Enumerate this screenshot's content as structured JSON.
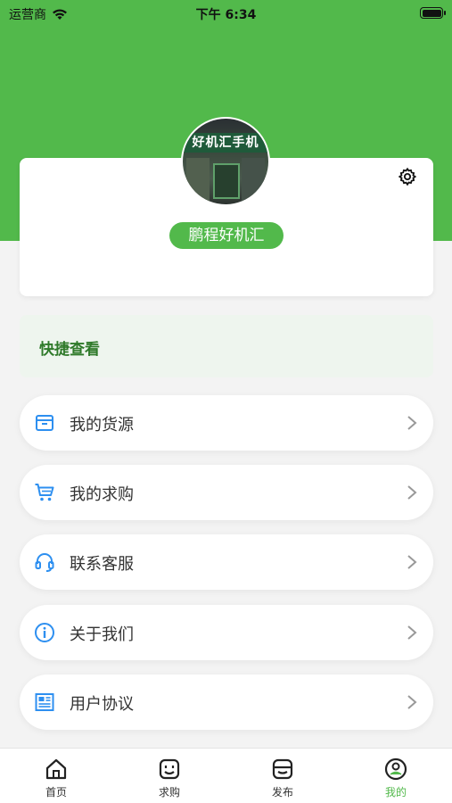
{
  "status_bar": {
    "carrier": "运营商",
    "time": "下午 6:34"
  },
  "profile": {
    "shop_name": "鹏程好机汇",
    "avatar_sign_text": "好机汇手机"
  },
  "quick_view": {
    "title": "快捷查看"
  },
  "menu": {
    "items": [
      {
        "label": "我的货源",
        "icon": "box-icon"
      },
      {
        "label": "我的求购",
        "icon": "cart-icon"
      },
      {
        "label": "联系客服",
        "icon": "headset-icon"
      },
      {
        "label": "关于我们",
        "icon": "info-icon"
      },
      {
        "label": "用户协议",
        "icon": "document-icon"
      }
    ]
  },
  "tab_bar": {
    "tabs": [
      {
        "label": "首页",
        "icon": "home-icon",
        "active": false
      },
      {
        "label": "求购",
        "icon": "smile-box-icon",
        "active": false
      },
      {
        "label": "发布",
        "icon": "store-icon",
        "active": false
      },
      {
        "label": "我的",
        "icon": "profile-icon",
        "active": true
      }
    ]
  },
  "colors": {
    "brand_green": "#52b94b",
    "icon_blue": "#2d8ff0",
    "background": "#f3f3f3"
  }
}
